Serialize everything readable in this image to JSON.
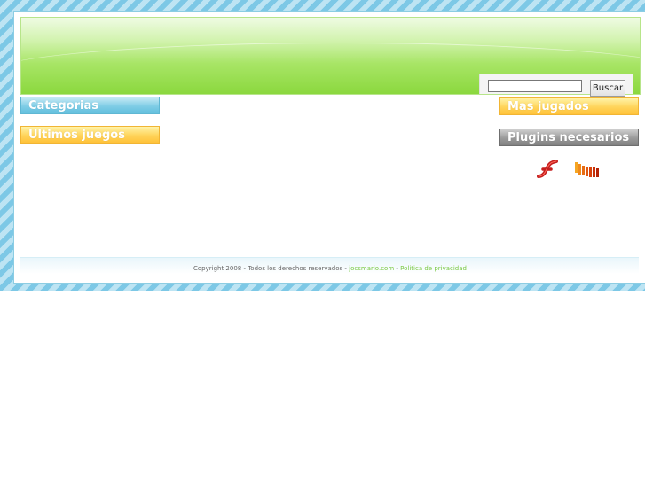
{
  "header": {
    "search": {
      "placeholder": "",
      "value": "",
      "button_label": "Buscar"
    }
  },
  "left": {
    "categories_title": "Categorias",
    "latest_title": "Ultimos juegos"
  },
  "right": {
    "most_played_title": "Mas jugados",
    "plugins_title": "Plugins necesarios",
    "plugins": [
      {
        "icon": "flash-player-icon"
      },
      {
        "icon": "shockwave-player-icon"
      }
    ]
  },
  "footer": {
    "copyright": "Copyright 2008 - Todos los derechos reservados - ",
    "site_link": "jocsmario.com",
    "separator": " - ",
    "privacy_link": "Politica de privacidad"
  },
  "colors": {
    "stripe_blue": "#7dc8e6",
    "header_green": "#8bd83e",
    "title_blue": "#62bfdd",
    "title_yellow": "#ffc23a",
    "title_gray": "#808080",
    "link_green": "#7ac943"
  }
}
